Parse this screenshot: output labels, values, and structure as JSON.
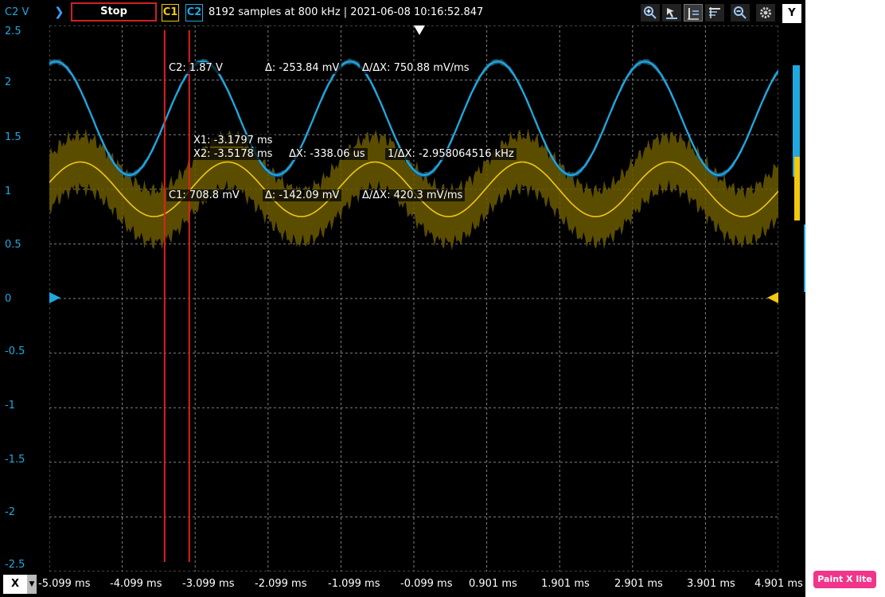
{
  "toolbar": {
    "unit_label": "C2 V",
    "stop_label": "Stop",
    "c1_label": "C1",
    "c2_label": "C2",
    "status": "8192 samples at 800 kHz | 2021-06-08 10:16:52.847",
    "y_label": "Y"
  },
  "bottom": {
    "x_label": "X"
  },
  "readouts": {
    "c2": "C2: 1.87 V",
    "c2_delta": "Δ: -253.84 mV",
    "c2_rate": "Δ/ΔX: 750.88 mV/ms",
    "x1": "X1: -3.1797 ms",
    "x2": "X2: -3.5178 ms",
    "dx": "ΔX: -338.06 us",
    "inv_dx": "1/ΔX: -2.958064516 kHz",
    "c1": "C1: 708.8 mV",
    "c1_delta": "Δ: -142.09 mV",
    "c1_rate": "Δ/ΔX: 420.3 mV/ms"
  },
  "badge": {
    "label": "Paint X lite"
  },
  "colors": {
    "c1": "#f2c80f",
    "c2": "#1fa8e0",
    "cursor": "#e02020",
    "grid": "#808080"
  },
  "chart_data": {
    "type": "line",
    "xlabel": "",
    "ylabel": "V",
    "xlim": [
      -5.099,
      4.901
    ],
    "ylim": [
      -2.5,
      2.5
    ],
    "x_ticks": [
      "-5.099 ms",
      "-4.099 ms",
      "-3.099 ms",
      "-2.099 ms",
      "-1.099 ms",
      "-0.099 ms",
      "0.901 ms",
      "1.901 ms",
      "2.901 ms",
      "3.901 ms",
      "4.901 ms"
    ],
    "y_ticks": [
      "2.5",
      "2",
      "1.5",
      "1",
      "0.5",
      "0",
      "-0.5",
      "-1",
      "-1.5",
      "-2",
      "-2.5"
    ],
    "grid": true,
    "cursors_x": [
      -3.5178,
      -3.1797
    ],
    "series": [
      {
        "channel": "C1",
        "offset": 1.0,
        "amplitude": 0.25,
        "frequency_khz": 0.495,
        "phase_deg": 203,
        "band": 0.32
      },
      {
        "channel": "C2",
        "offset": 1.65,
        "amplitude": 0.52,
        "frequency_khz": 0.495,
        "phase_deg": 263,
        "band": 0.03
      }
    ]
  }
}
